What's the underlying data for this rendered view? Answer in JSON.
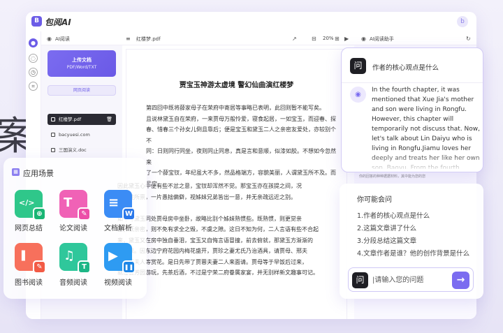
{
  "background_char": "案",
  "app": {
    "logo": "B",
    "title": "包阅AI",
    "avatar": "b"
  },
  "rail": {
    "icons": [
      "assistant-icon",
      "message-icon",
      "history-icon",
      "translate-icon"
    ]
  },
  "subbar": {
    "left_label": "AI阅读",
    "file_label": "红楼梦.pdf",
    "zoom": "20%",
    "right_label": "AI阅读助手"
  },
  "sidebar": {
    "upload_title": "上传文档",
    "upload_sub": "PDF/Word/TXT",
    "web_read": "网页阅读",
    "files": [
      "红楼梦.pdf",
      "bacyuesi.com",
      "三国演义.doc"
    ]
  },
  "document": {
    "title": "贾宝玉神游太虚境 警幻仙曲演红楼梦",
    "para1": "第四回中既将薛家母子在荣府中寄居等事略已表明，此回则暂不能写矣。\n且说林黛玉自在荣府，一来贾母万般怜爱，寝食起居，一如宝玉，而迎春、探\n春、惜春三个孙女儿倒且靠后；便是宝玉和黛玉二人之亲密友爱处，亦较别个不\n同：日则同行同坐，夜则同止同息，真是言和意顺，似漆如胶。不想如今忽然来\n了一个薛宝钗，年纪虽大不多，然品格端方，容貌美丽，人谓黛玉所不及。而且宝\n钗行为豁达，随分从时，不比黛玉孤高自许，目无下尘，故深得下人之心。便是那\n些小丫头子，亦多与宝钗顽笑。",
    "para2": "因此黛玉心中便有些不忿之意，宝钗却浑然不觉。那宝玉亦在孩提之间，况\n他天性所禀，一片愚拙偏僻，视姊妹兄弟皆出一意，并无亲疏远近之别。\n\n如今与黛玉同处贾母房中坐卧，故略比别个姊妹熟惯些。既熟惯，则更觉亲\n密；既亲密，则不免有求全之毁，不虞之隙。这日不知为何，二人言语有些不合起\n来，黛玉又在房中独自垂泪，宝玉又自悔言语冒撞，前去俯就，那黛玉方渐渐的\n回转来。因东边宁府花园内梅花盛开，贾珍之妻尤氏乃治酒具，请贾母、邢夫\n人、王夫人等赏花。是日先带了贾蓉夫妻二人来面请。贾母等于早饭后过来，\n就在会芳园游玩，先茶后酒，不过是宁荣二府眷属家宴，并无别样新文趣事可记。",
    "faded_line": "你的回答的种种据据材料，其中能为您的您"
  },
  "scenes": {
    "title": "应用场景",
    "items": [
      {
        "label": "网页总结",
        "glyph": "</>",
        "badge": "⊕",
        "color": "#2fc78a",
        "badge_color": "#19b574"
      },
      {
        "label": "论文阅读",
        "glyph": "T",
        "badge": "✎",
        "color": "#f062b6",
        "badge_color": "#ec4ea8"
      },
      {
        "label": "文档解析",
        "glyph": "≡",
        "badge": "W",
        "color": "#3b8cf5",
        "badge_color": "#2a78ea"
      },
      {
        "label": "图书阅读",
        "glyph": "❚",
        "badge": "✎",
        "color": "#f7705c",
        "badge_color": "#f25a45"
      },
      {
        "label": "音频阅读",
        "glyph": "♫",
        "badge": "T",
        "color": "#2fc79b",
        "badge_color": "#1db686"
      },
      {
        "label": "视频阅读",
        "glyph": "▶",
        "badge": "❚❚",
        "color": "#2e9bf2",
        "badge_color": "#1e86e6"
      }
    ]
  },
  "question": {
    "q_icon": "问",
    "text": "作者的核心观点是什么",
    "answer": "In the fourth chapter, it was mentioned that Xue Jia's mother and son were living in Rongfu. However, this chapter will temporarily not discuss that. Now, let's talk about Lin Daiyu who is living in Rongfu.Jiamu loves her deeply and treats her like her own son, Baoyu. From the fourth chapter..."
  },
  "suggestions": {
    "title": "你可能会问",
    "items": [
      "1.作者的核心观点是什么",
      "2.这篇文章讲了什么",
      "3.分段总结这篇文章",
      "4.文章作者是谁？他的创作背景是什么"
    ],
    "input_icon": "问",
    "placeholder": "|请输入您的问题",
    "send": "→"
  }
}
